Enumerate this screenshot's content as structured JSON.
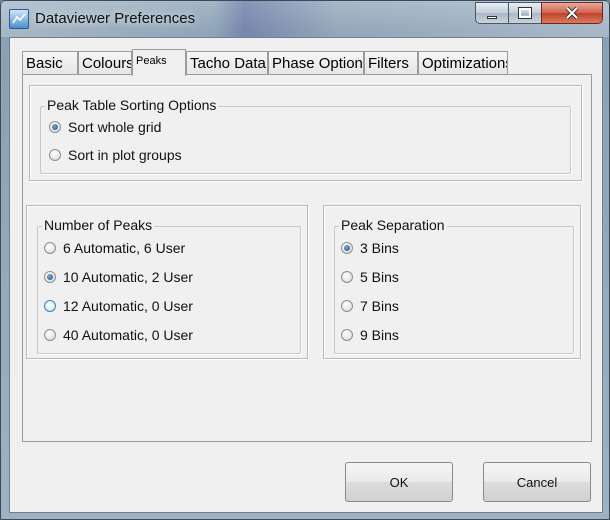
{
  "window": {
    "title": "Dataviewer Preferences"
  },
  "tabs": [
    {
      "label": "Basic"
    },
    {
      "label": "Colours"
    },
    {
      "label": "Peaks"
    },
    {
      "label": "Tacho Data"
    },
    {
      "label": "Phase Options"
    },
    {
      "label": "Filters"
    },
    {
      "label": "Optimizations"
    }
  ],
  "active_tab": "Peaks",
  "sorting": {
    "title": "Peak Table Sorting Options",
    "options": [
      {
        "label": "Sort whole grid",
        "selected": true
      },
      {
        "label": "Sort in plot groups",
        "selected": false
      }
    ]
  },
  "peaks": {
    "title": "Number of Peaks",
    "options": [
      {
        "label": "6 Automatic, 6 User",
        "selected": false
      },
      {
        "label": "10 Automatic, 2 User",
        "selected": true
      },
      {
        "label": "12 Automatic, 0 User",
        "selected": false
      },
      {
        "label": "40 Automatic, 0 User",
        "selected": false
      }
    ]
  },
  "separation": {
    "title": "Peak Separation",
    "options": [
      {
        "label": "3 Bins",
        "selected": true
      },
      {
        "label": "5 Bins",
        "selected": false
      },
      {
        "label": "7 Bins",
        "selected": false
      },
      {
        "label": "9 Bins",
        "selected": false
      }
    ]
  },
  "buttons": {
    "ok": "OK",
    "cancel": "Cancel"
  },
  "icons": {
    "app": "app-icon",
    "minimize": "minimize-icon",
    "maximize": "maximize-icon",
    "close": "close-icon"
  }
}
